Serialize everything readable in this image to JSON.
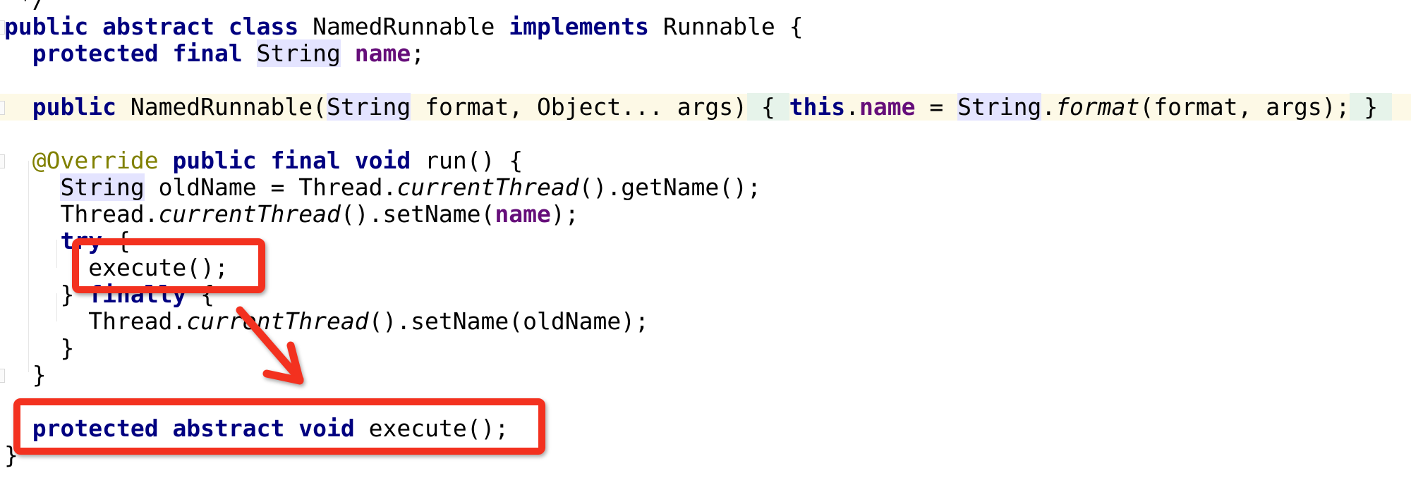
{
  "editor": {
    "lines": [
      [
        {
          "t": " */",
          "c": "comment"
        }
      ],
      [
        {
          "t": "public",
          "c": "kw"
        },
        {
          "t": " "
        },
        {
          "t": "abstract",
          "c": "kw"
        },
        {
          "t": " "
        },
        {
          "t": "class",
          "c": "kw"
        },
        {
          "t": " NamedRunnable "
        },
        {
          "t": "implements",
          "c": "kw"
        },
        {
          "t": " Runnable {"
        }
      ],
      [
        {
          "t": "  "
        },
        {
          "t": "protected",
          "c": "kw"
        },
        {
          "t": " "
        },
        {
          "t": "final",
          "c": "kw"
        },
        {
          "t": " "
        },
        {
          "t": "String",
          "c": "typehl"
        },
        {
          "t": " "
        },
        {
          "t": "name",
          "c": "field"
        },
        {
          "t": ";"
        }
      ],
      [],
      [
        {
          "t": "  "
        },
        {
          "t": "public",
          "c": "kw"
        },
        {
          "t": " NamedRunnable("
        },
        {
          "t": "String",
          "c": "typehl"
        },
        {
          "t": " format, Object... args)"
        },
        {
          "t": " { ",
          "c": "brace"
        },
        {
          "t": "this",
          "c": "kw"
        },
        {
          "t": "."
        },
        {
          "t": "name",
          "c": "field"
        },
        {
          "t": " = "
        },
        {
          "t": "String",
          "c": "typehl"
        },
        {
          "t": "."
        },
        {
          "t": "format",
          "c": "static"
        },
        {
          "t": "(format, args);"
        },
        {
          "t": " } ",
          "c": "brace"
        }
      ],
      [],
      [
        {
          "t": "  "
        },
        {
          "t": "@Override",
          "c": "ann"
        },
        {
          "t": " "
        },
        {
          "t": "public",
          "c": "kw"
        },
        {
          "t": " "
        },
        {
          "t": "final",
          "c": "kw"
        },
        {
          "t": " "
        },
        {
          "t": "void",
          "c": "kw"
        },
        {
          "t": " run() {"
        }
      ],
      [
        {
          "t": "    "
        },
        {
          "t": "String",
          "c": "typehl"
        },
        {
          "t": " oldName = Thread."
        },
        {
          "t": "currentThread",
          "c": "static"
        },
        {
          "t": "().getName();"
        }
      ],
      [
        {
          "t": "    Thread."
        },
        {
          "t": "currentThread",
          "c": "static"
        },
        {
          "t": "().setName("
        },
        {
          "t": "name",
          "c": "field"
        },
        {
          "t": ");"
        }
      ],
      [
        {
          "t": "    "
        },
        {
          "t": "try",
          "c": "kw"
        },
        {
          "t": " {"
        }
      ],
      [
        {
          "t": "      execute();"
        }
      ],
      [
        {
          "t": "    } "
        },
        {
          "t": "finally",
          "c": "kw"
        },
        {
          "t": " {"
        }
      ],
      [
        {
          "t": "      Thread."
        },
        {
          "t": "currentThread",
          "c": "static"
        },
        {
          "t": "().setName(oldName);"
        }
      ],
      [
        {
          "t": "    }"
        }
      ],
      [
        {
          "t": "  }"
        }
      ],
      [],
      [
        {
          "t": "  "
        },
        {
          "t": "protected",
          "c": "kw"
        },
        {
          "t": " "
        },
        {
          "t": "abstract",
          "c": "kw"
        },
        {
          "t": " "
        },
        {
          "t": "void",
          "c": "kw"
        },
        {
          "t": " execute();"
        }
      ],
      [
        {
          "t": "}"
        }
      ]
    ],
    "current_line": 4
  },
  "annotations": {
    "color": "#f3311f",
    "boxes": [
      "execute-call-box",
      "abstract-execute-declaration-box"
    ],
    "arrow": "arrow-from-call-to-declaration"
  }
}
